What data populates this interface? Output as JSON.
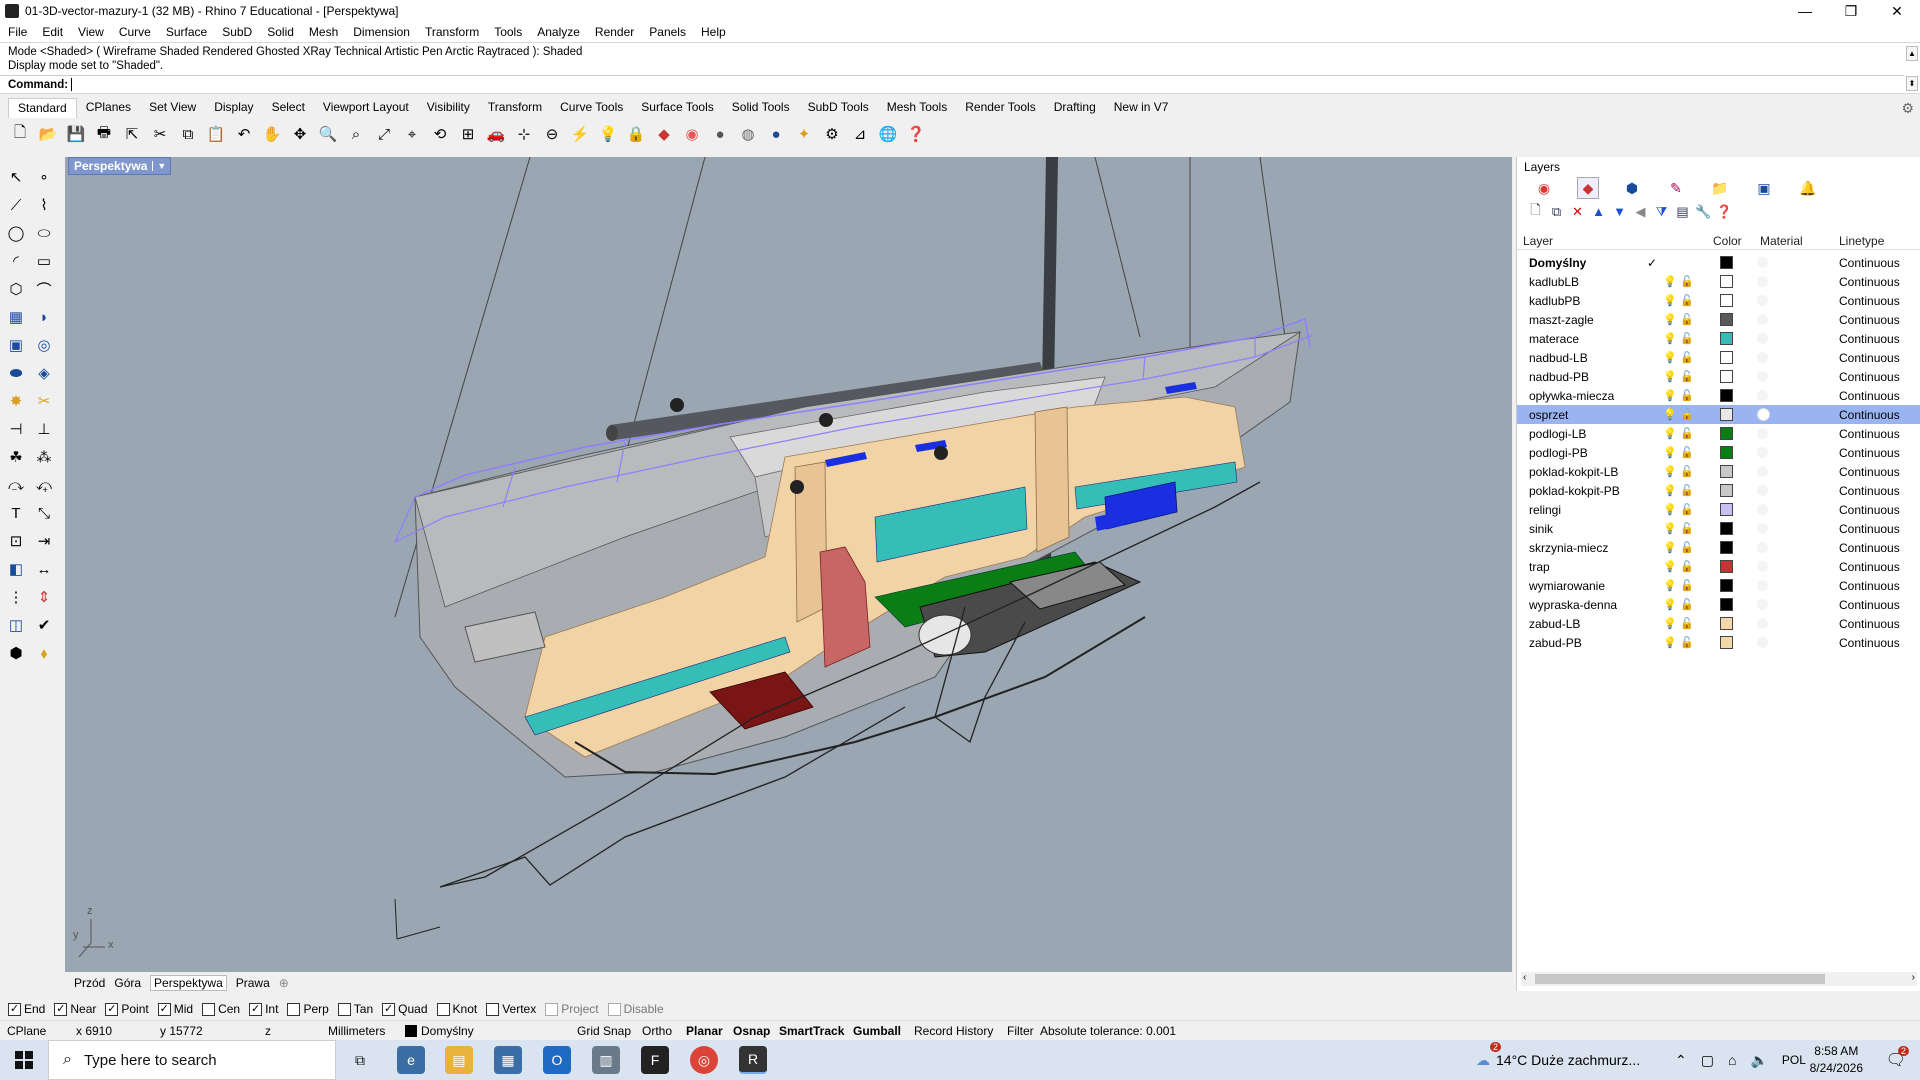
{
  "window": {
    "title": "01-3D-vector-mazury-1 (32 MB) - Rhino 7 Educational - [Perspektywa]",
    "minimize": "—",
    "maximize": "❐",
    "close": "✕"
  },
  "menu": [
    "File",
    "Edit",
    "View",
    "Curve",
    "Surface",
    "SubD",
    "Solid",
    "Mesh",
    "Dimension",
    "Transform",
    "Tools",
    "Analyze",
    "Render",
    "Panels",
    "Help"
  ],
  "command": {
    "history1": "Mode <Shaded> ( Wireframe  Shaded  Rendered  Ghosted  XRay  Technical  Artistic  Pen  Arctic  Raytraced ): Shaded",
    "history2": "Display mode set to \"Shaded\".",
    "prompt": "Command:",
    "value": ""
  },
  "toolbar_tabs": [
    "Standard",
    "CPlanes",
    "Set View",
    "Display",
    "Select",
    "Viewport Layout",
    "Visibility",
    "Transform",
    "Curve Tools",
    "Surface Tools",
    "Solid Tools",
    "SubD Tools",
    "Mesh Tools",
    "Render Tools",
    "Drafting",
    "New in V7"
  ],
  "toolbar_active_tab": "Standard",
  "viewport": {
    "name": "Perspektywa",
    "axis_x": "x",
    "axis_y": "y",
    "axis_z": "z"
  },
  "viewport_tabs": [
    "Przód",
    "Góra",
    "Perspektywa",
    "Prawa"
  ],
  "viewport_tab_add": "⊕",
  "osnaps": [
    {
      "label": "End",
      "checked": true
    },
    {
      "label": "Near",
      "checked": true
    },
    {
      "label": "Point",
      "checked": true
    },
    {
      "label": "Mid",
      "checked": true
    },
    {
      "label": "Cen",
      "checked": false
    },
    {
      "label": "Int",
      "checked": true
    },
    {
      "label": "Perp",
      "checked": false
    },
    {
      "label": "Tan",
      "checked": false
    },
    {
      "label": "Quad",
      "checked": true
    },
    {
      "label": "Knot",
      "checked": false
    },
    {
      "label": "Vertex",
      "checked": false
    },
    {
      "label": "Project",
      "checked": false
    },
    {
      "label": "Disable",
      "checked": false
    }
  ],
  "status": {
    "cplane": "CPlane",
    "x": "x 6910",
    "y": "y 15772",
    "z": "z",
    "units": "Millimeters",
    "layer": "Domyślny",
    "grid_snap": "Grid Snap",
    "ortho": "Ortho",
    "planar": "Planar",
    "osnap": "Osnap",
    "smarttrack": "SmartTrack",
    "gumball": "Gumball",
    "record_history": "Record History",
    "filter": "Filter",
    "tolerance": "Absolute tolerance: 0.001"
  },
  "layers_panel": {
    "title": "Layers",
    "col_layer": "Layer",
    "col_color": "Color",
    "col_material": "Material",
    "col_linetype": "Linetype",
    "current_mark": "✓",
    "rows": [
      {
        "name": "Domyślny",
        "color": "#000000",
        "linetype": "Continuous",
        "current": true
      },
      {
        "name": "kadlubLB",
        "color": "#ffffff",
        "linetype": "Continuous"
      },
      {
        "name": "kadlubPB",
        "color": "#ffffff",
        "linetype": "Continuous"
      },
      {
        "name": "maszt-zagle",
        "color": "#5a5a5a",
        "linetype": "Continuous"
      },
      {
        "name": "materace",
        "color": "#33bdb6",
        "linetype": "Continuous"
      },
      {
        "name": "nadbud-LB",
        "color": "#ffffff",
        "linetype": "Continuous"
      },
      {
        "name": "nadbud-PB",
        "color": "#ffffff",
        "linetype": "Continuous"
      },
      {
        "name": "opływka-miecza",
        "color": "#000000",
        "linetype": "Continuous"
      },
      {
        "name": "osprzet",
        "color": "#e8e8e8",
        "linetype": "Continuous",
        "selected": true
      },
      {
        "name": "podlogi-LB",
        "color": "#0a7d14",
        "linetype": "Continuous"
      },
      {
        "name": "podlogi-PB",
        "color": "#0a7d14",
        "linetype": "Continuous"
      },
      {
        "name": "poklad-kokpit-LB",
        "color": "#c8c8c8",
        "linetype": "Continuous"
      },
      {
        "name": "poklad-kokpit-PB",
        "color": "#c8c8c8",
        "linetype": "Continuous"
      },
      {
        "name": "relingi",
        "color": "#c8c0f0",
        "linetype": "Continuous"
      },
      {
        "name": "sinik",
        "color": "#000000",
        "linetype": "Continuous"
      },
      {
        "name": "skrzynia-miecz",
        "color": "#000000",
        "linetype": "Continuous"
      },
      {
        "name": "trap",
        "color": "#c83232",
        "linetype": "Continuous"
      },
      {
        "name": "wymiarowanie",
        "color": "#000000",
        "linetype": "Continuous"
      },
      {
        "name": "wypraska-denna",
        "color": "#000000",
        "linetype": "Continuous"
      },
      {
        "name": "zabud-LB",
        "color": "#f5d8a8",
        "linetype": "Continuous"
      },
      {
        "name": "zabud-PB",
        "color": "#f5d8a8",
        "linetype": "Continuous"
      }
    ]
  },
  "taskbar": {
    "search_placeholder": "Type here to search",
    "weather": "14°C  Duże zachmurz...",
    "language": "POL",
    "time": "8:58 AM",
    "date": "8/24/2026",
    "notification_badge": "2"
  }
}
